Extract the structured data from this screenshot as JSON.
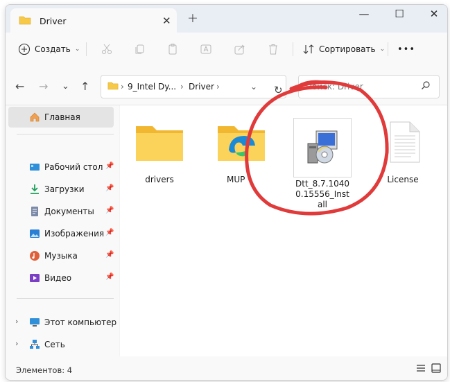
{
  "window": {
    "tab_title": "Driver",
    "new_tab": "+",
    "min": "—",
    "max": "☐",
    "close": "✕"
  },
  "toolbar": {
    "create_label": "Создать",
    "sort_label": "Сортировать",
    "more": "•••"
  },
  "address": {
    "crumbs": [
      "9_Intel Dy...",
      "Driver"
    ],
    "search_placeholder": "Поиск: Driver"
  },
  "sidebar": {
    "home": "Главная",
    "items": [
      {
        "label": "Рабочий стол",
        "icon": "desktop-icon"
      },
      {
        "label": "Загрузки",
        "icon": "download-icon"
      },
      {
        "label": "Документы",
        "icon": "documents-icon"
      },
      {
        "label": "Изображения",
        "icon": "pictures-icon"
      },
      {
        "label": "Музыка",
        "icon": "music-icon"
      },
      {
        "label": "Видео",
        "icon": "video-icon"
      }
    ],
    "this_pc": "Этот компьютер",
    "network": "Сеть"
  },
  "files": [
    {
      "name": "drivers",
      "type": "folder"
    },
    {
      "name": "MUP",
      "type": "folder-edge"
    },
    {
      "name": "Dtt_8.7.10400.15556_Install",
      "type": "installer"
    },
    {
      "name": "License",
      "type": "text"
    }
  ],
  "status": {
    "count": "Элементов: 4"
  },
  "colors": {
    "accent": "#0067c0",
    "highlight": "#e03a3a",
    "folder": "#f7c948"
  }
}
